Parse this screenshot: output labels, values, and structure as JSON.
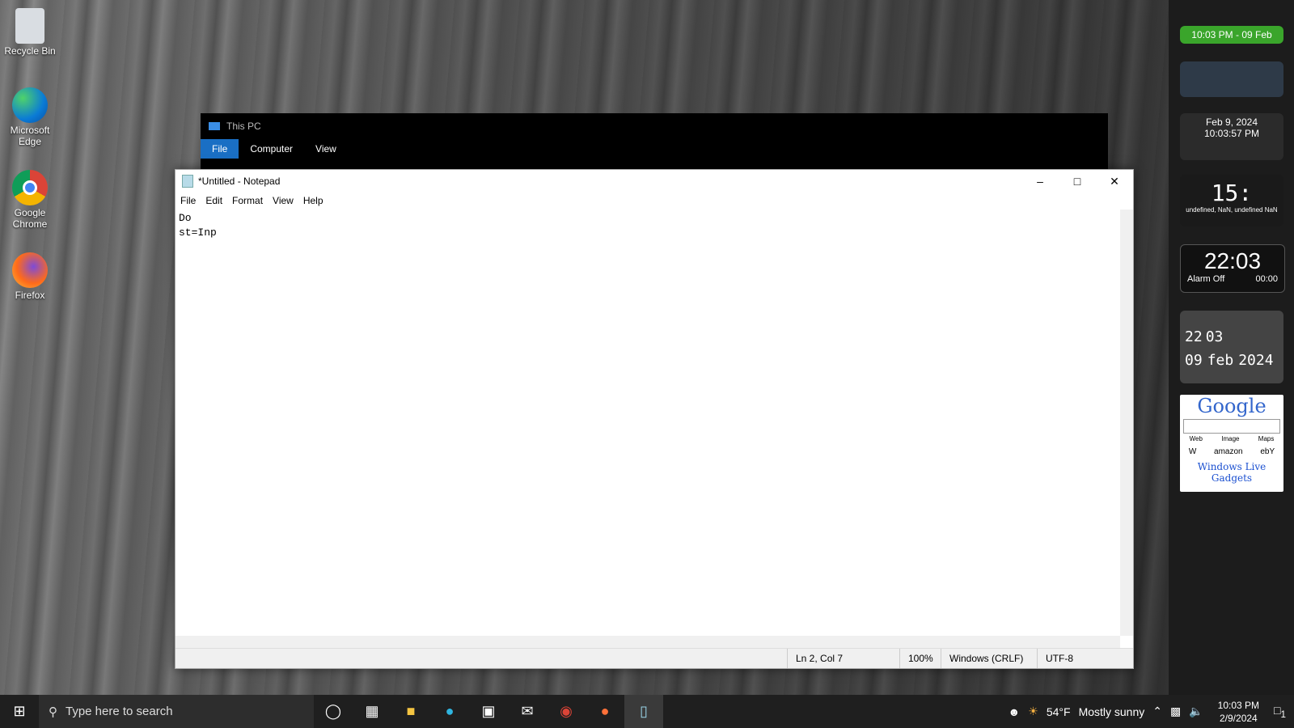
{
  "desktop": {
    "icons": [
      {
        "name": "recycle-bin",
        "label": "Recycle Bin"
      },
      {
        "name": "microsoft-edge",
        "label": "Microsoft Edge"
      },
      {
        "name": "google-chrome",
        "label": "Google Chrome"
      },
      {
        "name": "firefox",
        "label": "Firefox"
      }
    ]
  },
  "explorer": {
    "title": "This PC",
    "tabs": [
      "File",
      "Computer",
      "View"
    ]
  },
  "notepad": {
    "title": "*Untitled - Notepad",
    "menu": [
      "File",
      "Edit",
      "Format",
      "View",
      "Help"
    ],
    "content": "Do\nst=Inp",
    "status": {
      "position": "Ln 2, Col 7",
      "zoom": "100%",
      "line_ending": "Windows (CRLF)",
      "encoding": "UTF-8"
    }
  },
  "gadgets": {
    "top_clock": "10:03 PM - 09 Feb",
    "date_widget": {
      "date": "Feb 9, 2024",
      "time": "10:03:57 PM"
    },
    "digital": {
      "time": "15:",
      "sub": "undefined, NaN, undefined NaN"
    },
    "alarm": {
      "time": "22:03",
      "label": "Alarm Off",
      "value": "00:00"
    },
    "flip": {
      "hour": "22",
      "minute": "03",
      "day": "09",
      "month": "feb",
      "year": "2024"
    },
    "google": {
      "logo": "Google",
      "options": [
        "Web",
        "Image",
        "Maps"
      ],
      "link": "Windows Live Gadgets",
      "sites": [
        "W",
        "amazon",
        "ebY"
      ]
    }
  },
  "taskbar": {
    "search_placeholder": "Type here to search",
    "weather": {
      "temp": "54°F",
      "desc": "Mostly sunny"
    },
    "clock": {
      "time": "10:03 PM",
      "date": "2/9/2024"
    },
    "notification_count": "1"
  }
}
